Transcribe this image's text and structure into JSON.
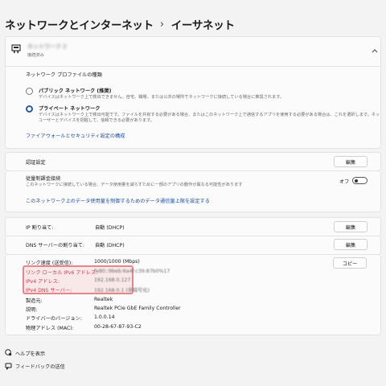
{
  "breadcrumb": {
    "parent": "ネットワークとインターネット",
    "separator": "›",
    "current": "イーサネット"
  },
  "adapter": {
    "name_blurred": "ネットワーク 2",
    "status": "接続済み"
  },
  "profile": {
    "heading": "ネットワーク プロファイルの種類",
    "public": {
      "label": "パブリック ネットワーク (推奨)",
      "desc": "デバイスはネットワーク上で検出できません。自宅、職場、または公共の場所でネットワークに接続している場合に推奨されます。"
    },
    "private": {
      "label": "プライベート ネットワーク",
      "desc_line1": "デバイスはネットワーク上で検出可能です。ファイルを共有する必要がある場合、またはこのネットワーク上で通信するアプリを使用する必要がある場合は、これを選択します。ネットワーク上のユーザーと",
      "desc_line2": "ユーザーとデバイスを把握して、信頼できる必要があります。"
    },
    "firewall_link": "ファイアウォールとセキュリティ設定の構成"
  },
  "auth": {
    "label": "認証設定",
    "button": "編集"
  },
  "metered": {
    "label": "従量制課金接続",
    "desc": "このネットワークに接続している場合、データ使用量を減らすために一部のアプリの動作が異なる可能性があります",
    "toggle_label": "オフ",
    "link": "このネットワーク上のデータ使用量を制御するためのデータ通信量上限を設定する"
  },
  "ip_assign": {
    "label": "IP 割り当て:",
    "value": "自動 (DHCP)",
    "button": "編集"
  },
  "dns_assign": {
    "label": "DNS サーバーの割り当て:",
    "value": "自動 (DHCP)",
    "button": "編集"
  },
  "properties": {
    "copy_button": "コピー",
    "rows": [
      {
        "label": "リンク速度 (送受信):",
        "value": "1000/1000 (Mbps)"
      },
      {
        "label": "リンク ローカル IPv6 アドレス:",
        "value": "fe80::9beb:6a4f:c39:87b0%17"
      },
      {
        "label": "IPv4 アドレス:",
        "value": "192.168.0.127"
      },
      {
        "label": "IPv4 DNS サーバー:",
        "value": "192.168.0.1 (非暗号化)"
      },
      {
        "label": "製造元:",
        "value": "Realtek"
      },
      {
        "label": "説明:",
        "value": "Realtek PCIe GbE Family Controller"
      },
      {
        "label": "ドライバーのバージョン:",
        "value": "1.0.0.14"
      },
      {
        "label": "物理アドレス (MAC):",
        "value": "00-28-67-87-93-C2"
      }
    ]
  },
  "footer": {
    "help": "ヘルプを表示",
    "feedback": "フィードバックの送信"
  },
  "colors": {
    "accent": "#2c5aa0",
    "highlight_border": "#e8858b",
    "link": "#1b4f9c",
    "page_bg": "#f3f3f3"
  },
  "icons": [
    "network-adapter-icon",
    "chevron-up-icon",
    "help-icon",
    "feedback-icon"
  ]
}
